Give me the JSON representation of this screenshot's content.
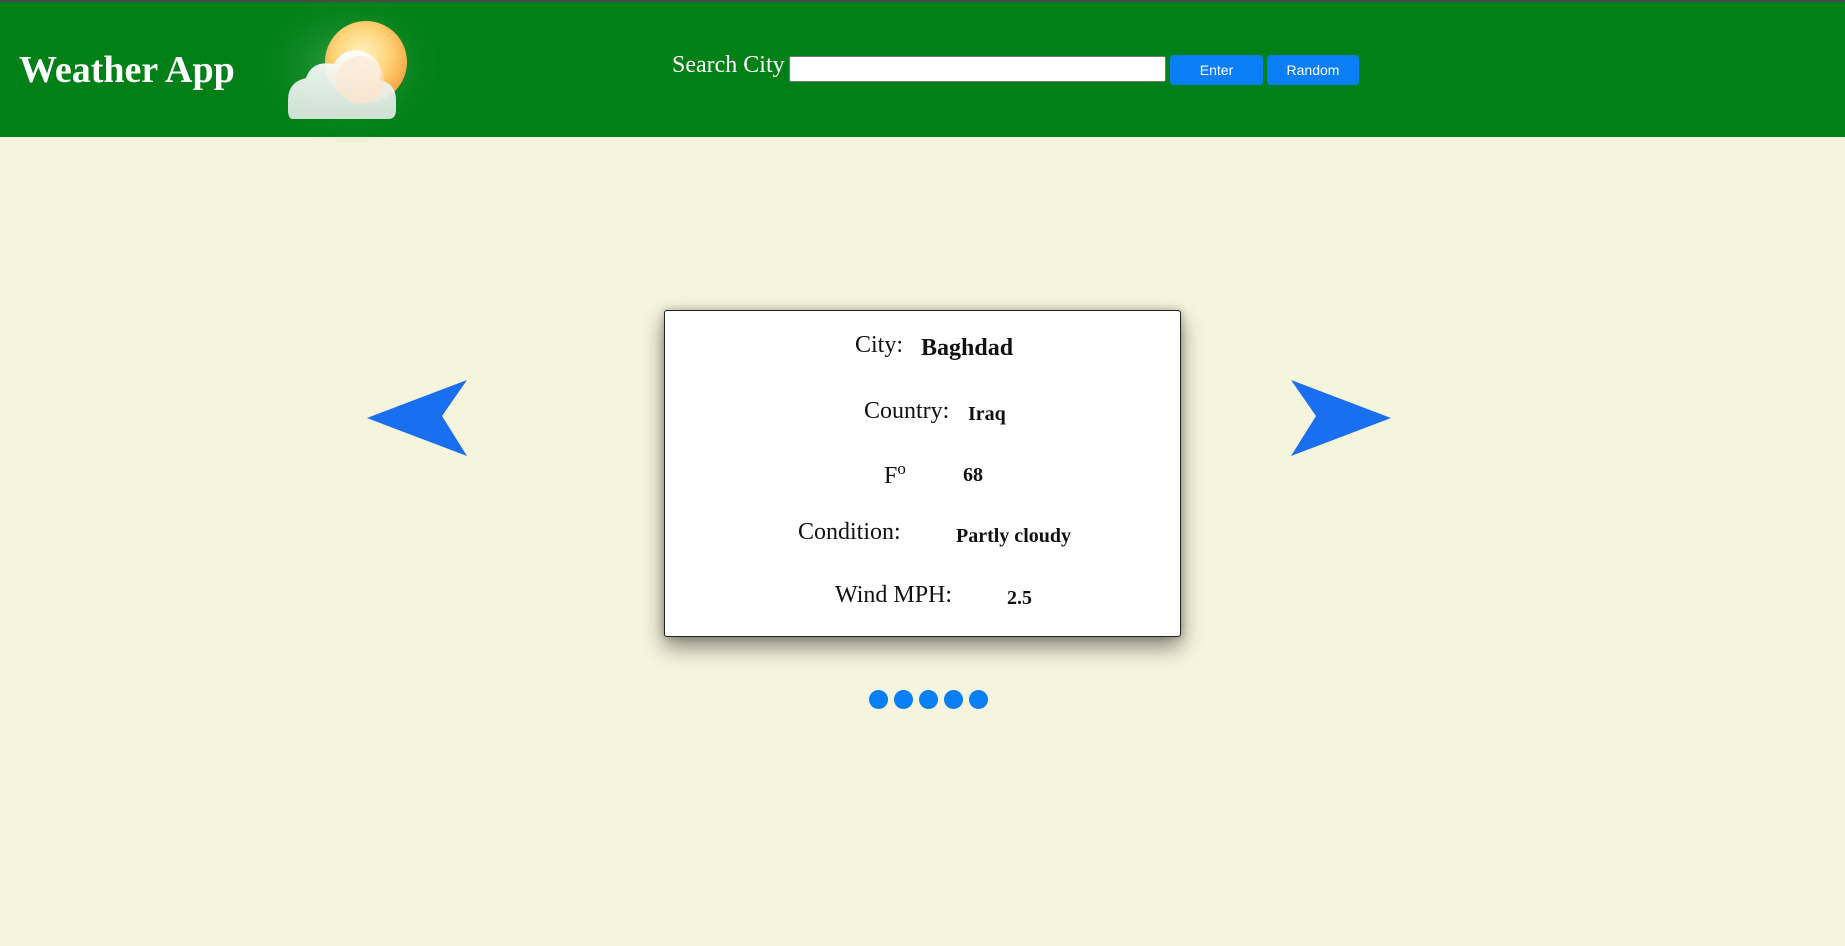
{
  "header": {
    "title": "Weather App",
    "logo_icon": "sun-behind-cloud-icon",
    "search_label": "Search City",
    "search_value": "",
    "enter_label": "Enter",
    "random_label": "Random",
    "background_color": "#028018",
    "button_color": "#0a7ef5"
  },
  "carousel": {
    "prev_icon": "arrow-left-icon",
    "next_icon": "arrow-right-icon",
    "arrow_color": "#1a6ef0",
    "dots_count": 5
  },
  "card": {
    "city_label": "City:",
    "city": "Baghdad",
    "country_label": "Country:",
    "country": "Iraq",
    "temp_label": "F",
    "temp_unit_sup": "o",
    "temp": "68",
    "condition_label": "Condition:",
    "condition": "Partly cloudy",
    "wind_label": "Wind MPH:",
    "wind": "2.5"
  },
  "page": {
    "background_color": "#f5f4dc"
  }
}
